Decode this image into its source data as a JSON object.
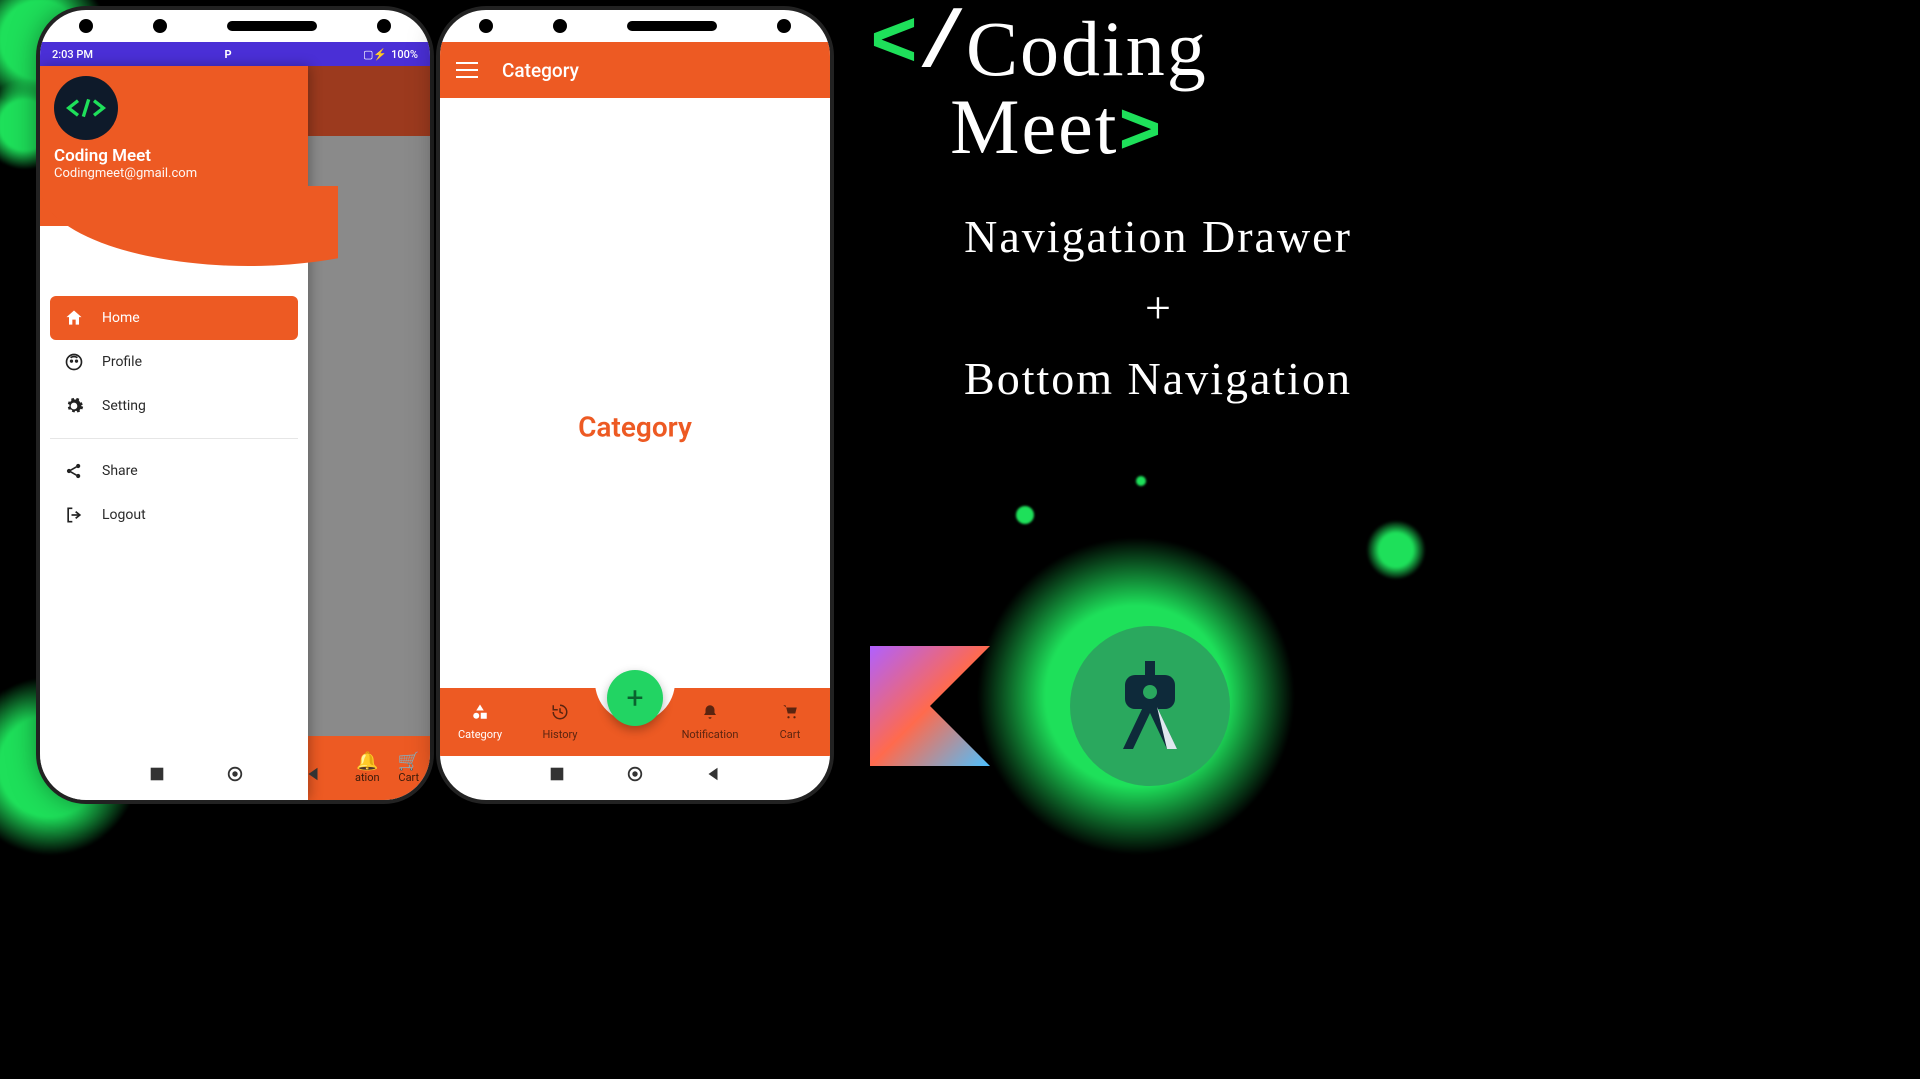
{
  "statusbar": {
    "time": "2:03 PM",
    "batteryText": "100%",
    "signalIcon": "P"
  },
  "drawer": {
    "userName": "Coding Meet",
    "userEmail": "Codingmeet@gmail.com",
    "items": [
      {
        "label": "Home",
        "active": true
      },
      {
        "label": "Profile",
        "active": false
      },
      {
        "label": "Setting",
        "active": false
      }
    ],
    "items2": [
      {
        "label": "Share"
      },
      {
        "label": "Logout"
      }
    ]
  },
  "bottomPeek": [
    {
      "label": "ation"
    },
    {
      "label": "Cart"
    }
  ],
  "toolbar2": {
    "title": "Category"
  },
  "page2": {
    "bodyText": "Category"
  },
  "bottomNav": [
    {
      "label": "Category",
      "active": true
    },
    {
      "label": "History",
      "active": false
    },
    {
      "label": "Notification",
      "active": false
    },
    {
      "label": "Cart",
      "active": false
    }
  ],
  "fab": {
    "glyph": "+"
  },
  "brand": {
    "wordTop": "Coding",
    "wordBottom": "Meet",
    "headline1": "Navigation Drawer",
    "plus": "+",
    "headline2": "Bottom Navigation"
  }
}
